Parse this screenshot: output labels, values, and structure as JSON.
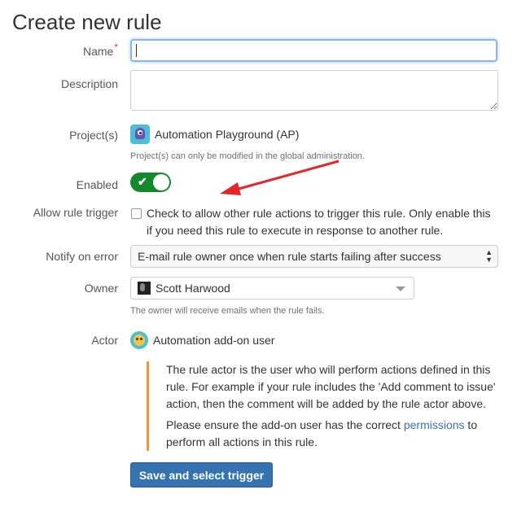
{
  "page": {
    "title": "Create new rule"
  },
  "form": {
    "name": {
      "label": "Name",
      "required_marker": "*",
      "value": ""
    },
    "description": {
      "label": "Description",
      "value": ""
    },
    "projects": {
      "label": "Project(s)",
      "value": "Automation Playground (AP)",
      "help": "Project(s) can only be modified in the global administration."
    },
    "enabled": {
      "label": "Enabled",
      "checked": true,
      "check_glyph": "✔"
    },
    "allow_rule_trigger": {
      "label": "Allow rule trigger",
      "checked": false,
      "text": "Check to allow other rule actions to trigger this rule. Only enable this if you need this rule to execute in response to another rule."
    },
    "notify_on_error": {
      "label": "Notify on error",
      "selected": "E-mail rule owner once when rule starts failing after success"
    },
    "owner": {
      "label": "Owner",
      "value": "Scott Harwood",
      "help": "The owner will receive emails when the rule fails."
    },
    "actor": {
      "label": "Actor",
      "value": "Automation add-on user",
      "note_p1": "The rule actor is the user who will perform actions defined in this rule. For example if your rule includes the 'Add comment to issue' action, then the comment will be added by the rule actor above.",
      "note_p2_before": "Please ensure the add-on user has the correct ",
      "note_p2_link": "permissions",
      "note_p2_after": " to perform all actions in this rule."
    },
    "submit_label": "Save and select trigger"
  },
  "colors": {
    "toggle_on": "#14892c",
    "primary_button": "#3572b0",
    "note_border": "#f79232",
    "link": "#3b73af",
    "required": "#d04437",
    "annotation_arrow": "#e5262d"
  }
}
